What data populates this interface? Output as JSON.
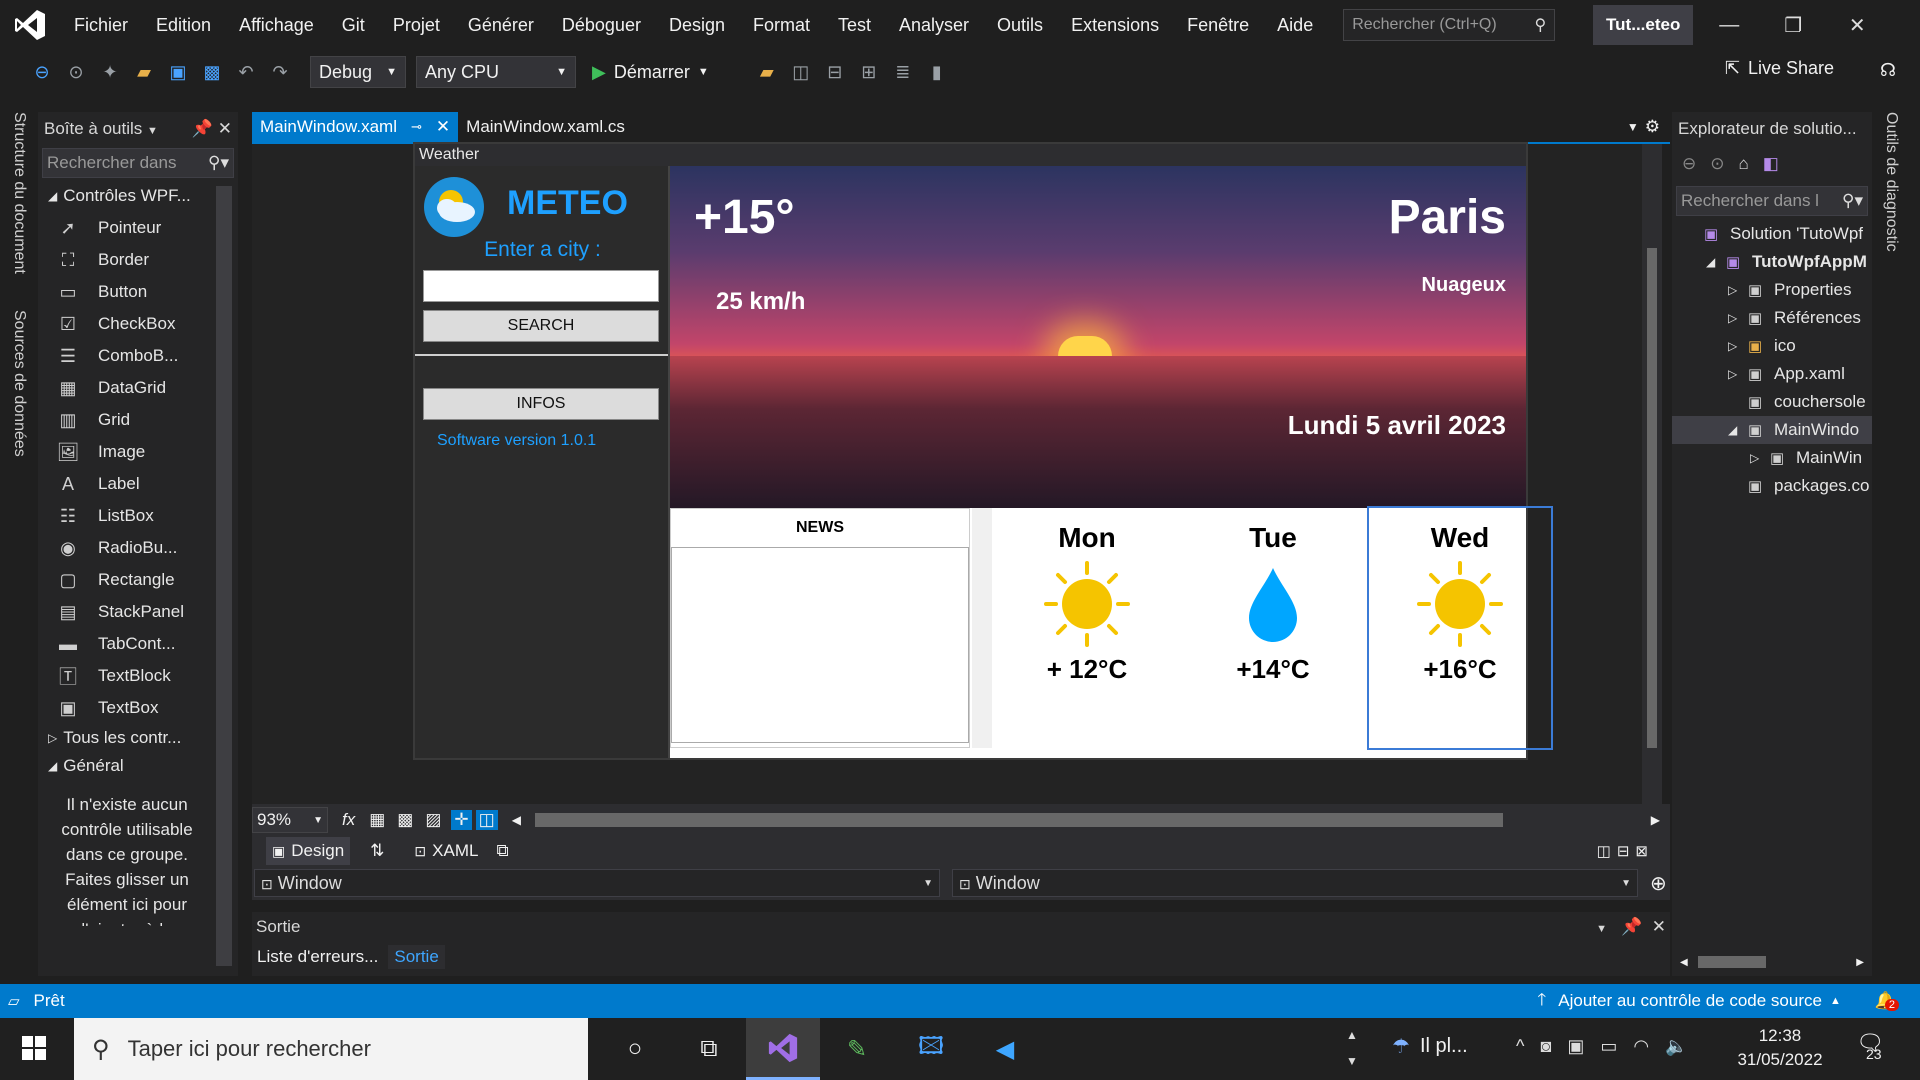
{
  "menu": {
    "items": [
      "Fichier",
      "Edition",
      "Affichage",
      "Git",
      "Projet",
      "Générer",
      "Déboguer",
      "Design",
      "Format",
      "Test",
      "Analyser",
      "Outils",
      "Extensions",
      "Fenêtre",
      "Aide"
    ],
    "search_placeholder": "Rechercher (Ctrl+Q)",
    "project_badge": "Tut...eteo"
  },
  "toolbar": {
    "config": "Debug",
    "platform": "Any CPU",
    "start": "Démarrer",
    "liveshare": "Live Share"
  },
  "side_tabs": {
    "left1": "Structure du document",
    "left2": "Sources de données",
    "right1": "Outils de diagnostic"
  },
  "toolbox": {
    "title": "Boîte à outils",
    "search": "Rechercher dans",
    "group": "Contrôles WPF...",
    "items": [
      {
        "label": "Pointeur",
        "icon": "pointer-icon",
        "glyph": "➚"
      },
      {
        "label": "Border",
        "icon": "border-icon",
        "glyph": "⛶"
      },
      {
        "label": "Button",
        "icon": "button-icon",
        "glyph": "▭"
      },
      {
        "label": "CheckBox",
        "icon": "checkbox-icon",
        "glyph": "☑"
      },
      {
        "label": "ComboB...",
        "icon": "combobox-icon",
        "glyph": "☰"
      },
      {
        "label": "DataGrid",
        "icon": "datagrid-icon",
        "glyph": "▦"
      },
      {
        "label": "Grid",
        "icon": "grid-icon",
        "glyph": "▥"
      },
      {
        "label": "Image",
        "icon": "image-icon",
        "glyph": "🖼"
      },
      {
        "label": "Label",
        "icon": "label-icon",
        "glyph": "A"
      },
      {
        "label": "ListBox",
        "icon": "listbox-icon",
        "glyph": "☷"
      },
      {
        "label": "RadioBu...",
        "icon": "radiobutton-icon",
        "glyph": "◉"
      },
      {
        "label": "Rectangle",
        "icon": "rectangle-icon",
        "glyph": "▢"
      },
      {
        "label": "StackPanel",
        "icon": "stackpanel-icon",
        "glyph": "▤"
      },
      {
        "label": "TabCont...",
        "icon": "tabcontrol-icon",
        "glyph": "▬"
      },
      {
        "label": "TextBlock",
        "icon": "textblock-icon",
        "glyph": "🅃"
      },
      {
        "label": "TextBox",
        "icon": "textbox-icon",
        "glyph": "▣"
      }
    ],
    "all_controls": "Tous les contr...",
    "general": "Général",
    "empty_msg": "Il n'existe aucun contrôle utilisable dans ce groupe. Faites glisser un élément ici pour l'ajouter à la"
  },
  "editor": {
    "tabs": [
      "MainWindow.xaml",
      "MainWindow.xaml.cs"
    ],
    "zoom": "93%",
    "design_tab": "Design",
    "xaml_tab": "XAML",
    "crumb_left": "Window",
    "crumb_right": "Window"
  },
  "wpf": {
    "window_title": "Weather",
    "app_name": "METEO",
    "city_prompt": "Enter a city :",
    "search_btn": "SEARCH",
    "infos_btn": "INFOS",
    "version": "Software version 1.0.1",
    "temp": "+15°",
    "wind": "25 km/h",
    "city": "Paris",
    "condition": "Nuageux",
    "date": "Lundi 5 avril 2023",
    "news": "NEWS",
    "days": [
      {
        "name": "Mon",
        "temp": "+ 12°C",
        "icon": "sun-icon"
      },
      {
        "name": "Tue",
        "temp": "+14°C",
        "icon": "raindrop-icon"
      },
      {
        "name": "Wed",
        "temp": "+16°C",
        "icon": "sun-icon"
      }
    ]
  },
  "output": {
    "title": "Sortie",
    "tab1": "Liste d'erreurs...",
    "tab2": "Sortie"
  },
  "solution": {
    "title": "Explorateur de solutio...",
    "search": "Rechercher dans l",
    "items": [
      {
        "label": "Solution 'TutoWpf",
        "indent": 0,
        "bold": false
      },
      {
        "label": "TutoWpfAppM",
        "indent": 1,
        "bold": true
      },
      {
        "label": "Properties",
        "indent": 2,
        "bold": false
      },
      {
        "label": "Références",
        "indent": 2,
        "bold": false
      },
      {
        "label": "ico",
        "indent": 2,
        "bold": false
      },
      {
        "label": "App.xaml",
        "indent": 2,
        "bold": false
      },
      {
        "label": "couchersole",
        "indent": 2,
        "bold": false
      },
      {
        "label": "MainWindo",
        "indent": 2,
        "bold": false
      },
      {
        "label": "MainWin",
        "indent": 3,
        "bold": false
      },
      {
        "label": "packages.co",
        "indent": 2,
        "bold": false
      }
    ]
  },
  "statusbar": {
    "ready": "Prêt",
    "source_control": "Ajouter au contrôle de code source",
    "notifications": "2"
  },
  "taskbar": {
    "search": "Taper ici pour rechercher",
    "weather": "Il pl...",
    "time": "12:38",
    "date": "31/05/2022",
    "notif_count": "23"
  },
  "colors": {
    "accent": "#007acc",
    "meteo_blue": "#1ea0ff",
    "sun": "#f5c400",
    "drop": "#00a6ff"
  }
}
